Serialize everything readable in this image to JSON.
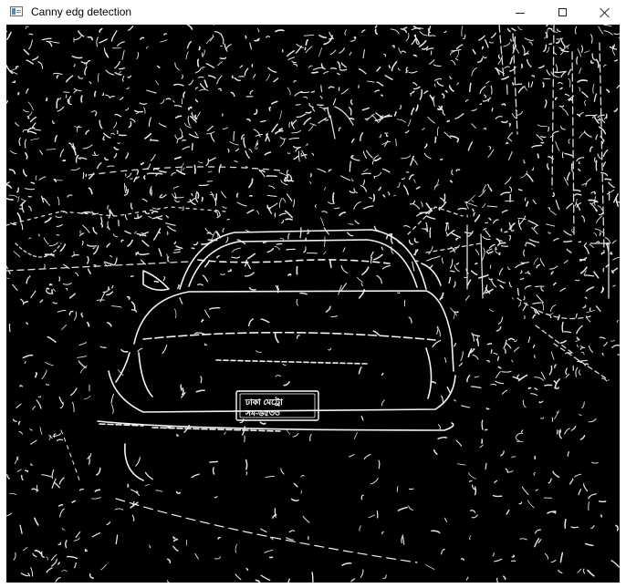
{
  "window": {
    "title": "Canny edg detection",
    "icon": "opencv-window-icon"
  },
  "controls": {
    "minimize": "minimize-icon",
    "maximize": "maximize-icon",
    "close": "close-icon"
  },
  "image": {
    "description_icon": "edge-image",
    "background_color": "#000000",
    "edge_color": "#ffffff",
    "plate_top": "ঢাকা মেট্রো",
    "plate_bottom": "সম-৬৫৩৩"
  }
}
